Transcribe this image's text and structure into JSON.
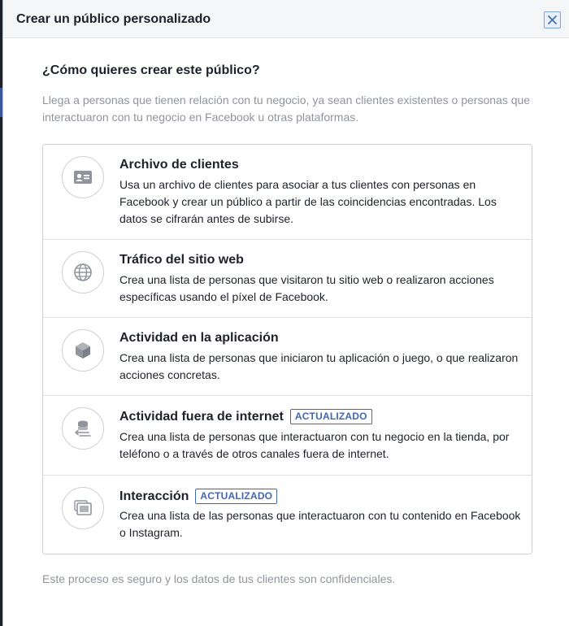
{
  "dialog": {
    "title": "Crear un público personalizado",
    "close_icon": "close-icon"
  },
  "question": "¿Cómo quieres crear este público?",
  "intro": "Llega a personas que tienen relación con tu negocio, ya sean clientes existentes o personas que interactuaron con tu negocio en Facebook u otras plataformas.",
  "options": [
    {
      "icon": "contact-card-icon",
      "title": "Archivo de clientes",
      "badge": "",
      "description": "Usa un archivo de clientes para asociar a tus clientes con personas en Facebook y crear un público a partir de las coincidencias encontradas. Los datos se cifrarán antes de subirse."
    },
    {
      "icon": "globe-icon",
      "title": "Tráfico del sitio web",
      "badge": "",
      "description": "Crea una lista de personas que visitaron tu sitio web o realizaron acciones específicas usando el píxel de Facebook."
    },
    {
      "icon": "cube-icon",
      "title": "Actividad en la aplicación",
      "badge": "",
      "description": "Crea una lista de personas que iniciaron tu aplicación o juego, o que realizaron acciones concretas."
    },
    {
      "icon": "offline-sync-icon",
      "title": "Actividad fuera de internet",
      "badge": "ACTUALIZADO",
      "description": "Crea una lista de personas que interactuaron con tu negocio en la tienda, por teléfono o a través de otros canales fuera de internet."
    },
    {
      "icon": "engagement-icon",
      "title": "Interacción",
      "badge": "ACTUALIZADO",
      "description": "Crea una lista de las personas que interactuaron con tu contenido en Facebook o Instagram."
    }
  ],
  "footer_note": "Este proceso es seguro y los datos de tus clientes son confidenciales.",
  "colors": {
    "accent": "#4267b2",
    "text_primary": "#1d2129",
    "text_secondary": "#90949c",
    "border": "#ccd0d5"
  }
}
